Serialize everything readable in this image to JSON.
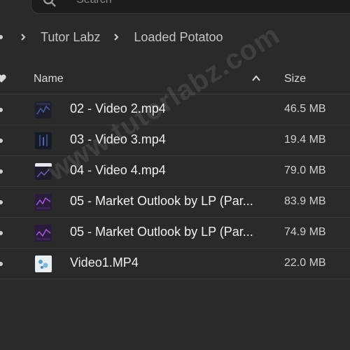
{
  "search": {
    "placeholder": "Search"
  },
  "breadcrumb": {
    "items": [
      "Tutor Labz",
      "Loaded Potatoo"
    ]
  },
  "list_header": {
    "name": "Name",
    "size": "Size",
    "sort_icon": "chevron-up-icon"
  },
  "files": [
    {
      "name": "02 - Video 2.mp4",
      "size": "46.5 MB",
      "thumb": "video-thumbnail-dark"
    },
    {
      "name": "03 - Video 3.mp4",
      "size": "19.4 MB",
      "thumb": "video-thumbnail-dark"
    },
    {
      "name": "04 - Video 4.mp4",
      "size": "79.0 MB",
      "thumb": "video-thumbnail-light-top"
    },
    {
      "name": "05 - Market Outlook by LP (Par...",
      "size": "83.9 MB",
      "thumb": "video-thumbnail-purple"
    },
    {
      "name": "05 - Market Outlook by LP (Par...",
      "size": "74.9 MB",
      "thumb": "video-thumbnail-purple"
    },
    {
      "name": "Video1.MP4",
      "size": "22.0 MB",
      "thumb": "video-thumbnail-light"
    }
  ],
  "watermark": {
    "text": "www.tutorlabz.com"
  },
  "colors": {
    "background": "#2a2a2a",
    "text": "#f0f0f0",
    "muted": "#cfcfcf",
    "divider": "#3a3a3a"
  }
}
